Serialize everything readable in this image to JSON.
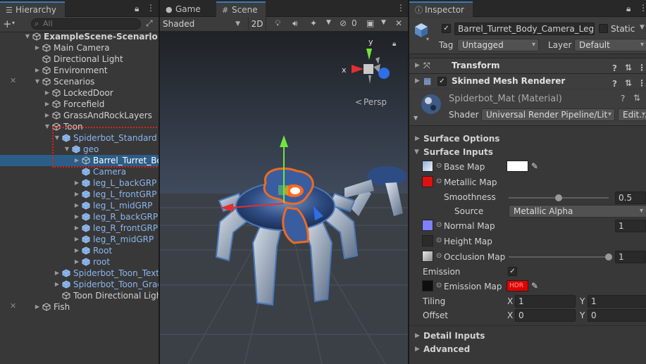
{
  "hierarchy": {
    "tab_label": "Hierarchy",
    "search_placeholder": "All",
    "rows": [
      {
        "label": "ExampleScene-Scenario",
        "kind": "scene",
        "expanded": true
      },
      {
        "label": "Main Camera",
        "kind": "object"
      },
      {
        "label": "Directional Light",
        "kind": "object"
      },
      {
        "label": "Environment",
        "kind": "object"
      },
      {
        "label": "Scenarios",
        "kind": "object",
        "expanded": true
      },
      {
        "label": "LockedDoor",
        "kind": "object"
      },
      {
        "label": "Forcefield",
        "kind": "object"
      },
      {
        "label": "GrassAndRockLayers",
        "kind": "object"
      },
      {
        "label": "Toon",
        "kind": "object",
        "expanded": true
      },
      {
        "label": "Spiderbot_Standard",
        "kind": "prefab",
        "expanded": true
      },
      {
        "label": "geo",
        "kind": "prefab",
        "expanded": true
      },
      {
        "label": "Barrel_Turret_Bo",
        "kind": "object",
        "selected": true
      },
      {
        "label": "Camera",
        "kind": "prefab"
      },
      {
        "label": "leg_L_backGRP",
        "kind": "prefab"
      },
      {
        "label": "leg_L_frontGRP",
        "kind": "prefab"
      },
      {
        "label": "leg_L_midGRP",
        "kind": "prefab"
      },
      {
        "label": "leg_R_backGRP",
        "kind": "prefab"
      },
      {
        "label": "leg_R_frontGRP",
        "kind": "prefab"
      },
      {
        "label": "leg_R_midGRP",
        "kind": "prefab"
      },
      {
        "label": "Root",
        "kind": "prefab"
      },
      {
        "label": "root",
        "kind": "prefab"
      },
      {
        "label": "Spiderbot_Toon_Textu",
        "kind": "prefab"
      },
      {
        "label": "Spiderbot_Toon_Grad",
        "kind": "prefab"
      },
      {
        "label": "Toon Directional Ligh",
        "kind": "object"
      },
      {
        "label": "Fish",
        "kind": "object"
      }
    ]
  },
  "scene_view": {
    "tab_game": "Game",
    "tab_scene": "Scene",
    "shading_mode": "Shaded",
    "mode_2d": "2D",
    "hidden_count": "0",
    "gizmo_x": "x",
    "gizmo_y": "y",
    "persp_label": "Persp"
  },
  "inspector": {
    "tab_label": "Inspector",
    "object_name": "Barrel_Turret_Body_Camera_Leg",
    "static_label": "Static",
    "tag_label": "Tag",
    "tag_value": "Untagged",
    "layer_label": "Layer",
    "layer_value": "Default",
    "components": {
      "transform": "Transform",
      "skinned_mesh": "Skinned Mesh Renderer"
    },
    "material": {
      "name": "Spiderbot_Mat (Material)",
      "shader_label": "Shader",
      "shader_value": "Universal Render Pipeline/Lit",
      "edit_button": "Edit..."
    },
    "sections": {
      "surface_options": "Surface Options",
      "surface_inputs": "Surface Inputs",
      "detail_inputs": "Detail Inputs",
      "advanced": "Advanced"
    },
    "props": {
      "base_map": "Base Map",
      "metallic_map": "Metallic Map",
      "smoothness": "Smoothness",
      "smoothness_value": "0.5",
      "smoothness_level": 0.5,
      "source": "Source",
      "source_value": "Metallic Alpha",
      "normal_map": "Normal Map",
      "normal_value": "1",
      "height_map": "Height Map",
      "occlusion_map": "Occlusion Map",
      "occlusion_value": "1",
      "occlusion_level": 1.0,
      "emission": "Emission",
      "emission_map": "Emission Map",
      "hdr_label": "HDR",
      "tiling": "Tiling",
      "tiling_x": "1",
      "tiling_y": "1",
      "offset": "Offset",
      "offset_x": "0",
      "offset_y": "0",
      "x_label": "X",
      "y_label": "Y"
    },
    "colors": {
      "base_color": "#ffffff",
      "emission_color": "#e00000",
      "metallic_thumb": "#e01010",
      "normal_thumb": "#8080ff"
    }
  }
}
